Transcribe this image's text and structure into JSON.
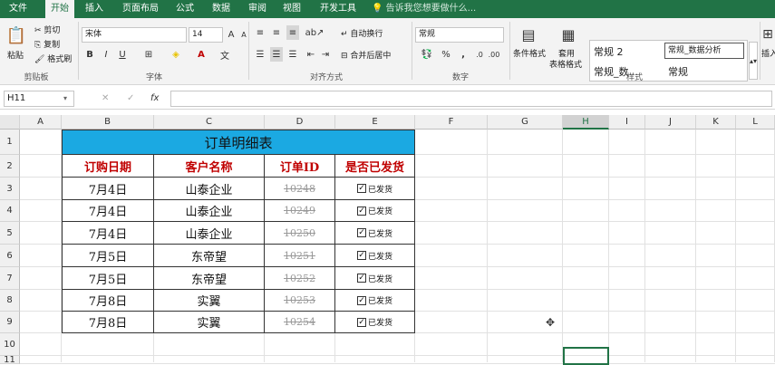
{
  "menu": {
    "tabs": [
      {
        "label": "文件"
      },
      {
        "label": "开始"
      },
      {
        "label": "插入"
      },
      {
        "label": "页面布局"
      },
      {
        "label": "公式"
      },
      {
        "label": "数据"
      },
      {
        "label": "审阅"
      },
      {
        "label": "视图"
      },
      {
        "label": "开发工具"
      }
    ],
    "tell_me": "告诉我您想要做什么..."
  },
  "ribbon": {
    "clipboard": {
      "paste": "粘贴",
      "cut": "剪切",
      "copy": "复制",
      "format_painter": "格式刷",
      "label": "剪贴板"
    },
    "font": {
      "name": "宋体",
      "size": "14",
      "bold": "B",
      "italic": "I",
      "underline": "U",
      "label": "字体"
    },
    "alignment": {
      "wrap": "自动换行",
      "merge": "合并后居中",
      "label": "对齐方式"
    },
    "number": {
      "format": "常规",
      "percent": "%",
      "comma": ",",
      "label": "数字"
    },
    "styles": {
      "conditional": "条件格式",
      "table_format": "套用\n表格格式",
      "table_format_l1": "套用",
      "table_format_l2": "表格格式",
      "cells": [
        "常规 2",
        "常规_数据分析",
        "常规_数...",
        "常规"
      ],
      "label": "样式"
    },
    "insert": "插入"
  },
  "formula_bar": {
    "name_box": "H11",
    "cancel": "✕",
    "enter": "✓",
    "fx": "fx",
    "value": ""
  },
  "grid": {
    "columns": [
      "A",
      "B",
      "C",
      "D",
      "E",
      "F",
      "G",
      "H",
      "I",
      "J",
      "K",
      "L"
    ],
    "rows": [
      "1",
      "2",
      "3",
      "4",
      "5",
      "6",
      "7",
      "8",
      "9",
      "10",
      "11"
    ],
    "selected_column": "H",
    "selected_cell": "H11"
  },
  "table": {
    "title": "订单明细表",
    "headers": [
      "订购日期",
      "客户名称",
      "订单ID",
      "是否已发货"
    ],
    "rows": [
      {
        "date": "7月4日",
        "customer": "山泰企业",
        "id": "10248",
        "shipped": "已发货"
      },
      {
        "date": "7月4日",
        "customer": "山泰企业",
        "id": "10249",
        "shipped": "已发货"
      },
      {
        "date": "7月4日",
        "customer": "山泰企业",
        "id": "10250",
        "shipped": "已发货"
      },
      {
        "date": "7月5日",
        "customer": "东帝望",
        "id": "10251",
        "shipped": "已发货"
      },
      {
        "date": "7月5日",
        "customer": "东帝望",
        "id": "10252",
        "shipped": "已发货"
      },
      {
        "date": "7月8日",
        "customer": "实翼",
        "id": "10253",
        "shipped": "已发货"
      },
      {
        "date": "7月8日",
        "customer": "实翼",
        "id": "10254",
        "shipped": "已发货"
      }
    ]
  },
  "colors": {
    "accent": "#217346",
    "title_fill": "#1ba9e2",
    "header_text": "#c00000"
  }
}
